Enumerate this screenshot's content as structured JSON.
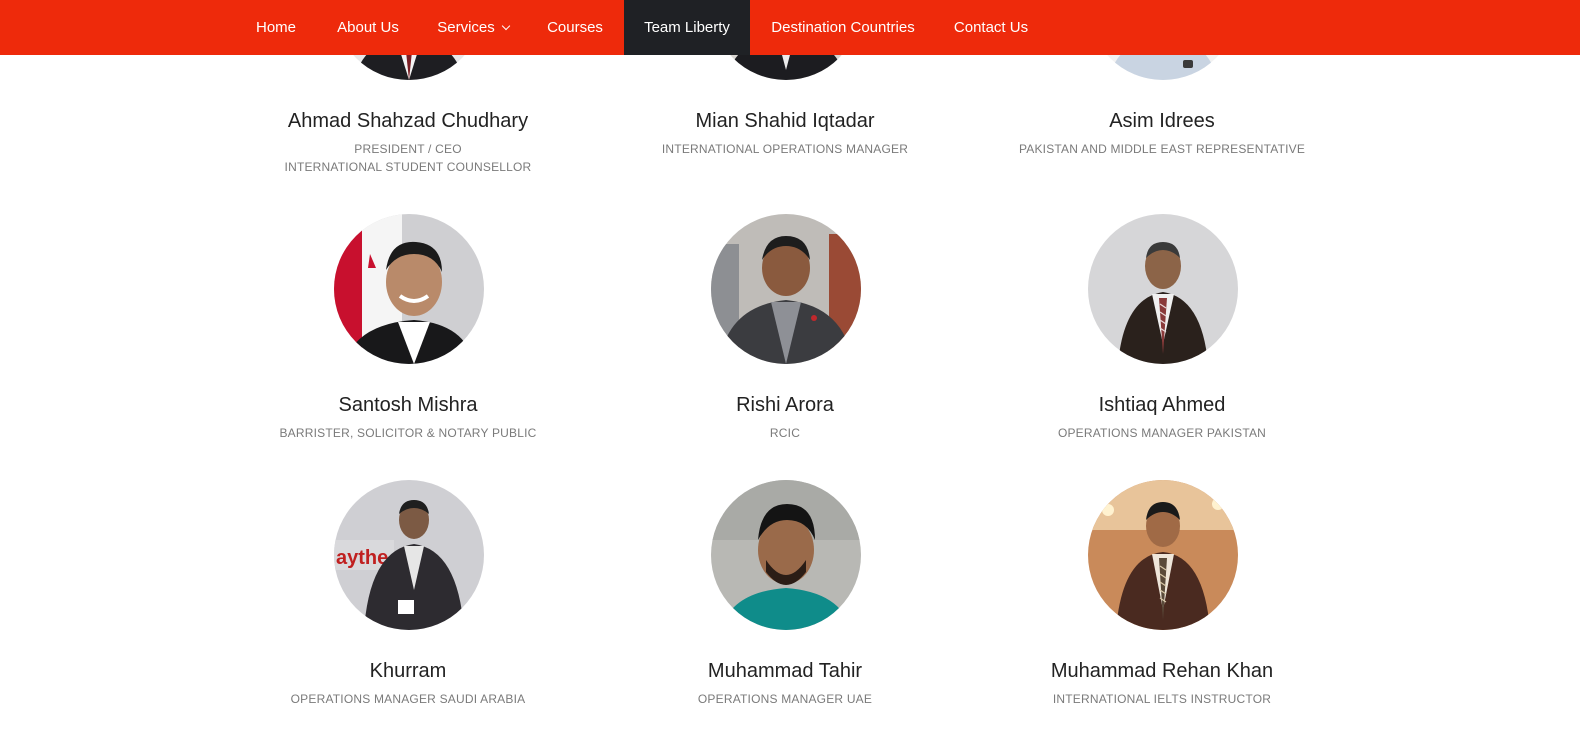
{
  "nav": {
    "items": [
      {
        "label": "Home"
      },
      {
        "label": "About Us"
      },
      {
        "label": "Services"
      },
      {
        "label": "Courses"
      },
      {
        "label": "Team Liberty"
      },
      {
        "label": "Destination Countries"
      },
      {
        "label": "Contact Us"
      }
    ],
    "active_item": "Team Liberty",
    "colors": {
      "bar": "#ee2a0b",
      "active": "#1f2125",
      "text": "#ffffff"
    },
    "icons": {
      "services_dropdown": "chevron-down-icon"
    }
  },
  "team": {
    "members": [
      {
        "name": "Ahmad Shahzad Chudhary",
        "role_line1": "PRESIDENT / CEO",
        "role_line2": "INTERNATIONAL STUDENT COUNSELLOR"
      },
      {
        "name": "Mian Shahid Iqtadar",
        "role_line1": "INTERNATIONAL OPERATIONS MANAGER"
      },
      {
        "name": "Asim Idrees",
        "role_line1": "PAKISTAN AND MIDDLE EAST REPRESENTATIVE"
      },
      {
        "name": "Santosh Mishra",
        "role_line1": "BARRISTER, SOLICITOR & NOTARY PUBLIC"
      },
      {
        "name": "Rishi Arora",
        "role_line1": "RCIC"
      },
      {
        "name": "Ishtiaq Ahmed",
        "role_line1": "OPERATIONS MANAGER PAKISTAN"
      },
      {
        "name": "Khurram",
        "role_line1": "OPERATIONS MANAGER SAUDI ARABIA"
      },
      {
        "name": "Muhammad Tahir",
        "role_line1": "OPERATIONS MANAGER UAE"
      },
      {
        "name": "Muhammad Rehan Khan",
        "role_line1": "INTERNATIONAL IELTS INSTRUCTOR"
      }
    ]
  }
}
